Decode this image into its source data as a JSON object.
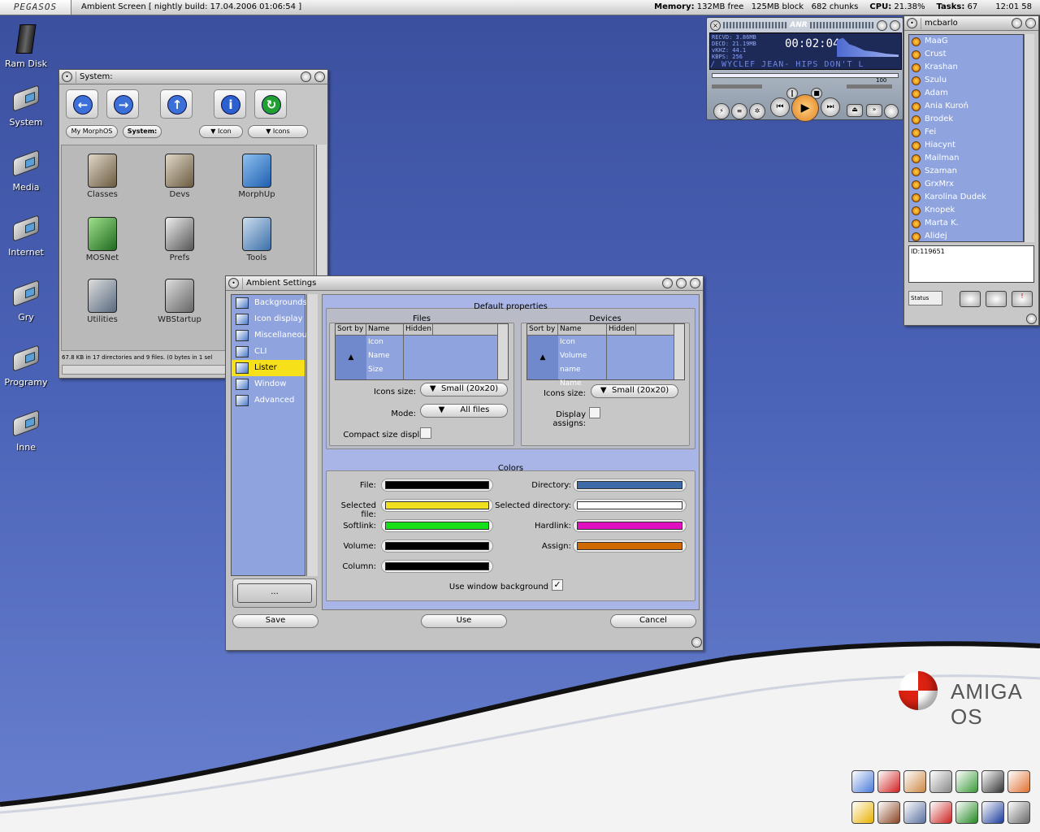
{
  "topbar": {
    "title": "Ambient Screen   [ nightly build: 17.04.2006 01:06:54 ]",
    "memory_label": "Memory:",
    "memory": " 132MB free   125MB block   682 chunks",
    "cpu_label": "CPU:",
    "cpu": " 21.38%",
    "tasks_label": "Tasks:",
    "tasks": " 67",
    "clock": "12:01 58"
  },
  "desktop": {
    "icons": [
      "Ram Disk",
      "System",
      "Media",
      "Internet",
      "Gry",
      "Programy",
      "Inne"
    ],
    "logo_text": "AMIGA OS"
  },
  "system_window": {
    "title": "System:",
    "path_buttons": [
      "My MorphOS",
      "System:"
    ],
    "view_cycle": [
      "Icon",
      "Icons"
    ],
    "icons": [
      "Classes",
      "Devs",
      "MorphUp",
      "MOSNet",
      "Prefs",
      "Tools",
      "Utilities",
      "WBStartup"
    ],
    "status": "67.8 KB in 17 directories and 9 files. (0 bytes in 1 sel"
  },
  "player": {
    "info": [
      "RECVD: 3.86MB",
      "DECD: 21.19MB",
      "vKHZ: 44.1",
      "KBPS: 256"
    ],
    "time": "00:02:04",
    "scroller": "/ WYCLEF JEAN- HIPS DON'T L",
    "volume": "100",
    "brand": "ANR"
  },
  "contacts": {
    "title": "mcbarlo",
    "list": [
      "MaaG",
      "Crust",
      "Krashan",
      "Szulu",
      "Adam",
      "Ania Kuroń",
      "Brodek",
      "Fei",
      "Hiacynt",
      "Mailman",
      "Szaman",
      "GrxMrx",
      "Karolina Dudek",
      "Knopek",
      "Marta K.",
      "Alidej"
    ],
    "id_text": "ID:119651",
    "status_label": "Status"
  },
  "ambient": {
    "title": "Ambient Settings",
    "sidebar": [
      "Backgrounds",
      "Icon display",
      "Miscellaneous",
      "CLI launching",
      "Lister",
      "Window",
      "Advanced"
    ],
    "selected": "Lister",
    "ellipsis": "...",
    "default_props": "Default properties",
    "files": {
      "title": "Files",
      "headers": [
        "Sort by",
        "Name",
        "Hidden"
      ],
      "rows": [
        "Icon",
        "Name",
        "Size"
      ],
      "sort_arrow": "▲",
      "icons_size_label": "Icons size:",
      "icons_size": "Small   (20x20)",
      "mode_label": "Mode:",
      "mode": "All files",
      "compact_label": "Compact size display:"
    },
    "devices": {
      "title": "Devices",
      "headers": [
        "Sort by",
        "Name",
        "Hidden"
      ],
      "rows": [
        "Icon",
        "Volume name",
        "Name"
      ],
      "sort_arrow": "▲",
      "icons_size_label": "Icons size:",
      "icons_size": "Small   (20x20)",
      "assigns_label": "Display assigns:"
    },
    "colors": {
      "title": "Colors",
      "left": [
        {
          "label": "File:",
          "color": "#000000"
        },
        {
          "label": "Selected file:",
          "color": "#f0e020"
        },
        {
          "label": "Softlink:",
          "color": "#18e018"
        },
        {
          "label": "Volume:",
          "color": "#000000"
        },
        {
          "label": "Column:",
          "color": "#000000"
        }
      ],
      "right": [
        {
          "label": "Directory:",
          "color": "#3e6aa8"
        },
        {
          "label": "Selected directory:",
          "color": "#ffffff"
        },
        {
          "label": "Hardlink:",
          "color": "#e010c0"
        },
        {
          "label": "Assign:",
          "color": "#d06a00"
        }
      ],
      "window_bg_label": "Use window background",
      "window_bg_check": "✓"
    },
    "buttons": {
      "save": "Save",
      "use": "Use",
      "cancel": "Cancel"
    }
  }
}
